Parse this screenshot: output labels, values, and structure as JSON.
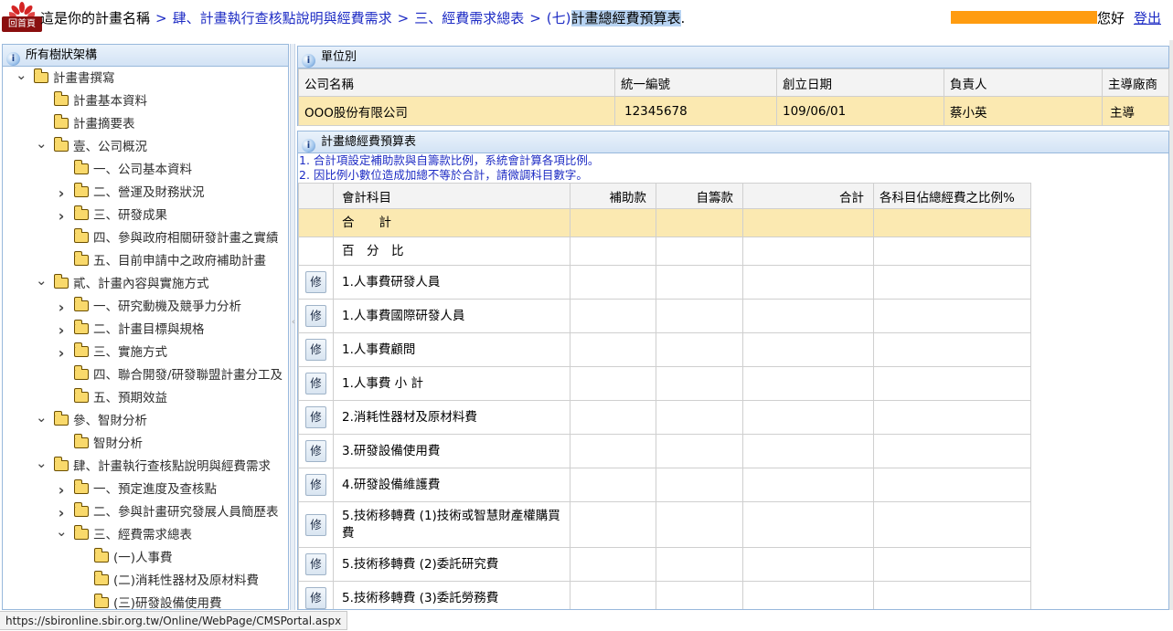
{
  "header": {
    "home_label": "回首頁",
    "breadcrumb": [
      {
        "text": "這是你的計畫名稱",
        "kind": "first"
      },
      {
        "text": "肆、計畫執行查核點說明與經費需求",
        "kind": "link"
      },
      {
        "text": "三、經費需求總表",
        "kind": "link"
      },
      {
        "text": "(七)",
        "kind": "link"
      },
      {
        "text": "計畫總經費預算表",
        "kind": "current"
      }
    ],
    "separator": ">",
    "trailing_period": ".",
    "greeting": "您好",
    "logout_label": "登出",
    "username_mask_color": "#ff9c10"
  },
  "tree": {
    "title": "所有樹狀架構",
    "items": [
      {
        "label": "計畫書撰寫",
        "level": 0,
        "toggle": "expanded"
      },
      {
        "label": "計畫基本資料",
        "level": 1,
        "toggle": "none"
      },
      {
        "label": "計畫摘要表",
        "level": 1,
        "toggle": "none"
      },
      {
        "label": "壹、公司概況",
        "level": 1,
        "toggle": "expanded"
      },
      {
        "label": "一、公司基本資料",
        "level": 2,
        "toggle": "none"
      },
      {
        "label": "二、營運及財務狀況",
        "level": 2,
        "toggle": "collapsed"
      },
      {
        "label": "三、研發成果",
        "level": 2,
        "toggle": "collapsed"
      },
      {
        "label": "四、參與政府相關研發計畫之實績",
        "level": 2,
        "toggle": "none"
      },
      {
        "label": "五、目前申請中之政府補助計畫",
        "level": 2,
        "toggle": "none"
      },
      {
        "label": "貳、計畫內容與實施方式",
        "level": 1,
        "toggle": "expanded"
      },
      {
        "label": "一、研究動機及競爭力分析",
        "level": 2,
        "toggle": "collapsed"
      },
      {
        "label": "二、計畫目標與規格",
        "level": 2,
        "toggle": "collapsed"
      },
      {
        "label": "三、實施方式",
        "level": 2,
        "toggle": "collapsed"
      },
      {
        "label": "四、聯合開發/研發聯盟計畫分工及",
        "level": 2,
        "toggle": "none"
      },
      {
        "label": "五、預期效益",
        "level": 2,
        "toggle": "none"
      },
      {
        "label": "參、智財分析",
        "level": 1,
        "toggle": "expanded"
      },
      {
        "label": "智財分析",
        "level": 2,
        "toggle": "none"
      },
      {
        "label": "肆、計畫執行查核點說明與經費需求",
        "level": 1,
        "toggle": "expanded"
      },
      {
        "label": "一、預定進度及查核點",
        "level": 2,
        "toggle": "collapsed"
      },
      {
        "label": "二、參與計畫研究發展人員簡歷表",
        "level": 2,
        "toggle": "collapsed"
      },
      {
        "label": "三、經費需求總表",
        "level": 2,
        "toggle": "expanded"
      },
      {
        "label": "(一)人事費",
        "level": 3,
        "toggle": "none"
      },
      {
        "label": "(二)消耗性器材及原材料費",
        "level": 3,
        "toggle": "none"
      },
      {
        "label": "(三)研發設備使用費",
        "level": 3,
        "toggle": "none"
      }
    ]
  },
  "unit": {
    "title": "單位別",
    "columns": [
      "公司名稱",
      "統一編號",
      "創立日期",
      "負責人",
      "主導廠商"
    ],
    "row": [
      "OOO股份有限公司",
      "12345678",
      "109/06/01",
      "蔡小英",
      "主導"
    ]
  },
  "budget": {
    "title": "計畫總經費預算表",
    "notes": [
      "1. 合計項設定補助款與自籌款比例，系統會計算各項比例。",
      "2. 因比例小數位造成加總不等於合計，請微調科目數字。"
    ],
    "columns": [
      "",
      "會計科目",
      "補助款",
      "自籌款",
      "合計",
      "各科目佔總經費之比例%"
    ],
    "total_label": "合　　計",
    "percent_label": "百　分　比",
    "edit_label": "修",
    "items": [
      {
        "subject": "1.人事費研發人員"
      },
      {
        "subject": "1.人事費國際研發人員"
      },
      {
        "subject": "1.人事費顧問"
      },
      {
        "subject": "1.人事費 小 計"
      },
      {
        "subject": "2.消耗性器材及原材料費"
      },
      {
        "subject": "3.研發設備使用費"
      },
      {
        "subject": "4.研發設備維護費"
      },
      {
        "subject": "5.技術移轉費 (1)技術或智慧財產權購買費"
      },
      {
        "subject": "5.技術移轉費 (2)委託研究費"
      },
      {
        "subject": "5.技術移轉費 (3)委託勞務費"
      }
    ]
  },
  "status_url": "https://sbironline.sbir.org.tw/Online/WebPage/CMSPortal.aspx"
}
